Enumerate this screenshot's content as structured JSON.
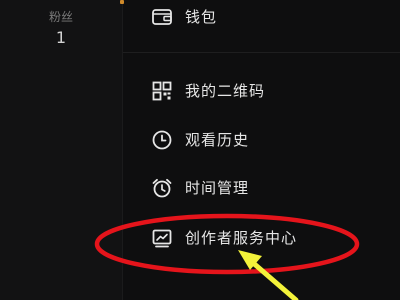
{
  "profile": {
    "fans_label": "粉丝",
    "fans_count": "1"
  },
  "menu": {
    "items": [
      {
        "label": "钱包",
        "icon": "wallet-icon"
      },
      {
        "label": "我的二维码",
        "icon": "qr-code-icon"
      },
      {
        "label": "观看历史",
        "icon": "clock-icon"
      },
      {
        "label": "时间管理",
        "icon": "alarm-clock-icon"
      },
      {
        "label": "创作者服务中心",
        "icon": "chart-icon"
      }
    ]
  },
  "annotation": {
    "ellipse_color": "#e5141b",
    "arrow_color": "#f3f23a"
  },
  "colors": {
    "background": "#0e0e0f",
    "left_panel": "#121213",
    "text": "#e6e6e6",
    "muted_text": "#7a7a7a"
  }
}
